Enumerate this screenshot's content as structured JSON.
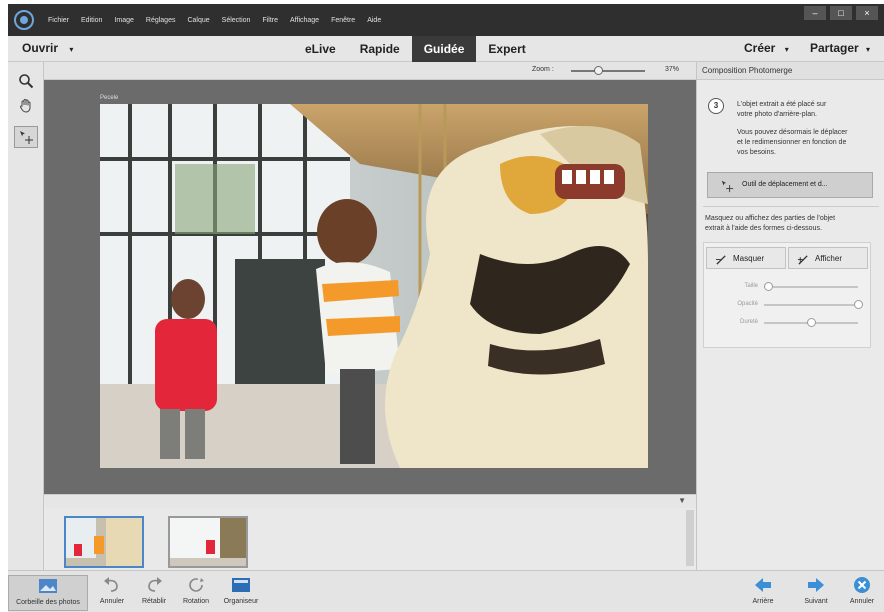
{
  "menubar": {
    "items": [
      "Fichier",
      "Edition",
      "Image",
      "Réglages",
      "Calque",
      "Sélection",
      "Filtre",
      "Affichage",
      "Fenêtre",
      "Aide"
    ]
  },
  "window_controls": [
    "–",
    "□",
    "×"
  ],
  "modebar": {
    "open_label": "Ouvrir",
    "tabs": [
      "eLive",
      "Rapide",
      "Guidée",
      "Expert"
    ],
    "active_tab": "Guidée",
    "create_label": "Créer",
    "share_label": "Partager"
  },
  "canvas": {
    "zoom_label": "Zoom :",
    "zoom_value": "37%",
    "zoom_fraction": 0.37,
    "layer_label": "Pecele"
  },
  "panel": {
    "title": "Composition Photomerge",
    "step_number": "3",
    "step_lines": [
      "L'objet extrait a été placé sur",
      "votre photo d'arrière-plan."
    ],
    "help_lines": [
      "Vous pouvez désormais le déplacer",
      "et le redimensionner en fonction de",
      "vos besoins."
    ],
    "move_button": "Outil de déplacement et d...",
    "mask_lines": [
      "Masquez ou affichez des parties de l'objet",
      "extrait à l'aide des formes ci-dessous."
    ],
    "hide_button": "Masquer",
    "show_button": "Afficher",
    "sliders": [
      {
        "label": "Taille",
        "value": 0.05
      },
      {
        "label": "Opacité",
        "value": 1.0
      },
      {
        "label": "Dureté",
        "value": 0.5
      }
    ]
  },
  "status": {
    "items": [
      "Corbeille des photos",
      "Annuler",
      "Rétablir",
      "Rotation",
      "Organiseur"
    ],
    "back": "Arrière",
    "next": "Suivant",
    "cancel": "Annuler"
  },
  "colors": {
    "accent": "#3a8fd6",
    "active_tab_bg": "#3a3a3a"
  }
}
